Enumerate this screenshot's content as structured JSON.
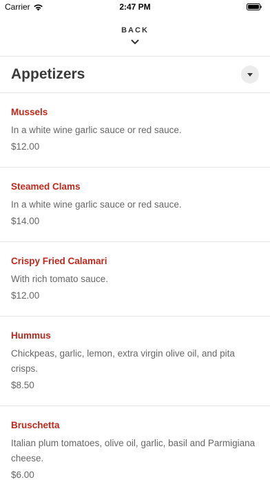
{
  "status_bar": {
    "carrier": "Carrier",
    "time": "2:47 PM"
  },
  "header": {
    "back_label": "BACK"
  },
  "section": {
    "title": "Appetizers"
  },
  "colors": {
    "item_name": "#c0281b",
    "text_secondary": "#666666",
    "divider": "#e6e6e6"
  },
  "icons": {
    "wifi": "wifi-icon",
    "battery": "battery-icon",
    "back_chevron": "chevron-down-icon",
    "section_toggle": "caret-down-icon"
  },
  "items": [
    {
      "name": "Mussels",
      "description": "In a white wine garlic sauce or red sauce.",
      "price": "$12.00"
    },
    {
      "name": "Steamed Clams",
      "description": "In a white wine garlic sauce or red sauce.",
      "price": "$14.00"
    },
    {
      "name": "Crispy Fried Calamari",
      "description": "With rich tomato sauce.",
      "price": "$12.00"
    },
    {
      "name": "Hummus",
      "description": "Chickpeas, garlic, lemon, extra virgin olive oil, and pita crisps.",
      "price": "$8.50"
    },
    {
      "name": "Bruschetta",
      "description": "Italian plum tomatoes, olive oil, garlic, basil and Parmigiana cheese.",
      "price": "$6.00"
    }
  ]
}
